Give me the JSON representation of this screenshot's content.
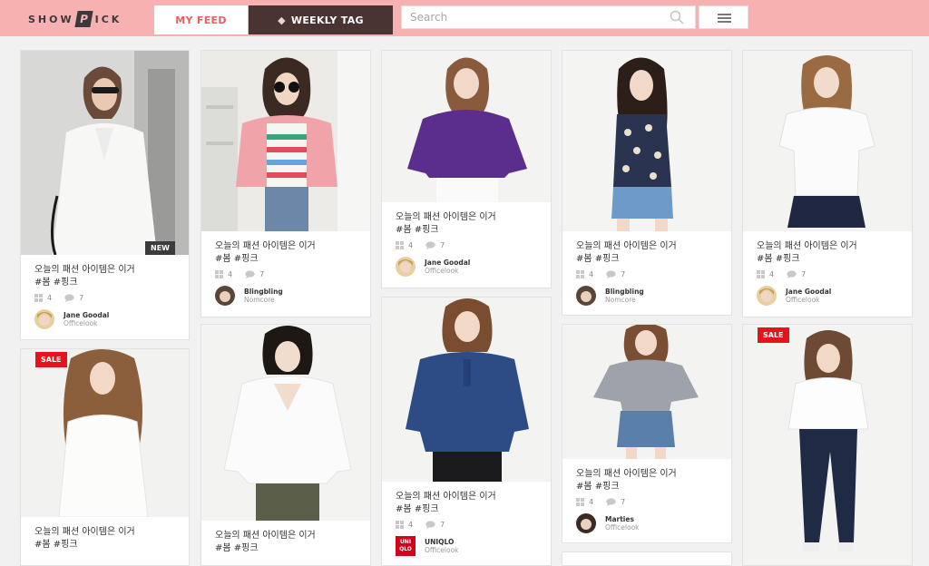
{
  "header": {
    "logo_left": "SHOW",
    "logo_p": "P",
    "logo_right": "ICK",
    "tabs": {
      "my_feed": "MY FEED",
      "weekly_tag": "WEEKLY TAG"
    },
    "search_placeholder": "Search"
  },
  "colors": {
    "header_bg": "#f8b1b1",
    "accent": "#ef5b62",
    "dark_tab": "#4a3333",
    "sale": "#e4141c"
  },
  "posts": [
    {
      "title": "오늘의 패션 아이템은 이거",
      "tags": "#봄 #핑크",
      "likes": "4",
      "comments": "7",
      "user": "Jane Goodal",
      "subtitle": "Officelook",
      "badge": "NEW"
    },
    {
      "title": "오늘의 패션 아이템은 이거",
      "tags": "#봄 #핑크",
      "likes": "4",
      "comments": "7",
      "user": "Blingbling",
      "subtitle": "Nomcore"
    },
    {
      "title": "오늘의 패션 아이템은 이거",
      "tags": "#봄 #핑크",
      "likes": "4",
      "comments": "7",
      "user": "Jane Goodal",
      "subtitle": "Officelook"
    },
    {
      "title": "오늘의 패션 아이템은 이거",
      "tags": "#봄 #핑크",
      "likes": "4",
      "comments": "7",
      "user": "Blingbling",
      "subtitle": "Nomcore"
    },
    {
      "title": "오늘의 패션 아이템은 이거",
      "tags": "#봄 #핑크",
      "likes": "4",
      "comments": "7",
      "user": "Jane Goodal",
      "subtitle": "Officelook"
    },
    {
      "title": "오늘의 패션 아이템은 이거",
      "tags": "#봄 #핑크",
      "badge": "SALE"
    },
    {
      "title": "오늘의 패션 아이템은 이거",
      "tags": "#봄 #핑크"
    },
    {
      "title": "오늘의 패션 아이템은 이거",
      "tags": "#봄 #핑크",
      "likes": "4",
      "comments": "7",
      "user": "UNIQLO",
      "subtitle": "Officelook",
      "avatar_text": "UNI\nQLO"
    },
    {
      "title": "오늘의 패션 아이템은 이거",
      "tags": "#봄 #핑크",
      "likes": "4",
      "comments": "7",
      "user": "Marties",
      "subtitle": "Officelook"
    },
    {
      "badge": "SALE"
    }
  ]
}
